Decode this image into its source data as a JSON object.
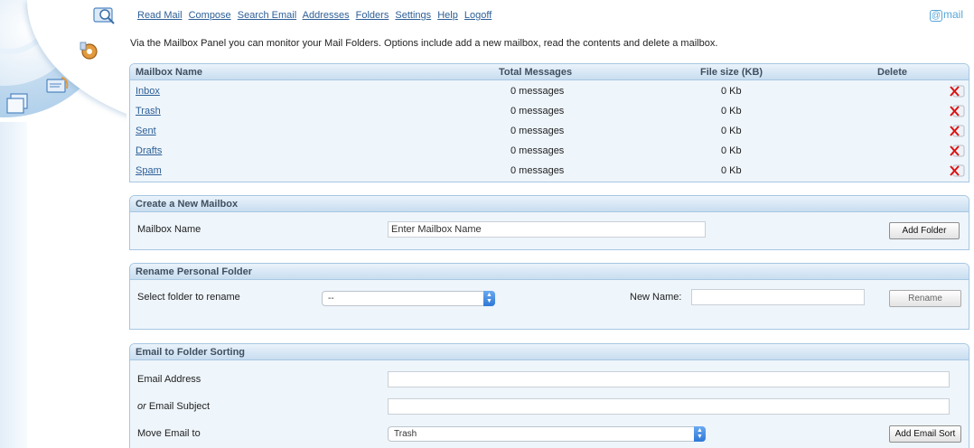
{
  "nav": {
    "items": [
      "Read Mail",
      "Compose",
      "Search Email",
      "Addresses",
      "Folders",
      "Settings",
      "Help",
      "Logoff"
    ],
    "brand": "mail",
    "brand_at": "@"
  },
  "intro": "Via the Mailbox Panel you can monitor your Mail Folders. Options include add a new mailbox, read the contents and delete a mailbox.",
  "mailboxes": {
    "headers": {
      "name": "Mailbox Name",
      "total": "Total Messages",
      "size": "File size (KB)",
      "delete": "Delete"
    },
    "rows": [
      {
        "name": "Inbox",
        "messages": "0 messages",
        "size": "0 Kb"
      },
      {
        "name": "Trash",
        "messages": "0 messages",
        "size": "0 Kb"
      },
      {
        "name": "Sent",
        "messages": "0 messages",
        "size": "0 Kb"
      },
      {
        "name": "Drafts",
        "messages": "0 messages",
        "size": "0 Kb"
      },
      {
        "name": "Spam",
        "messages": "0 messages",
        "size": "0 Kb"
      }
    ]
  },
  "create": {
    "title": "Create a New Mailbox",
    "label": "Mailbox Name",
    "input_value": "Enter Mailbox Name",
    "button": "Add Folder"
  },
  "rename": {
    "title": "Rename Personal Folder",
    "select_label": "Select folder to rename",
    "select_value": "--",
    "new_name_label": "New Name:",
    "new_name_value": "",
    "button": "Rename"
  },
  "sorting": {
    "title": "Email to Folder Sorting",
    "email_label": "Email Address",
    "email_value": "",
    "subject_label_or": "or",
    "subject_label": " Email Subject",
    "subject_value": "",
    "move_label": "Move Email to",
    "move_value": "Trash",
    "button": "Add Email Sort"
  },
  "colors": {
    "link": "#2d5f96",
    "brand": "#56a6d8",
    "panel_border": "#a7c7e2",
    "panel_bg": "#eef5fb"
  },
  "icons": [
    "read-mail-icon",
    "settings-icon",
    "compose-icon",
    "folders-icon",
    "delete-icon",
    "dropdown-arrow-icon"
  ]
}
